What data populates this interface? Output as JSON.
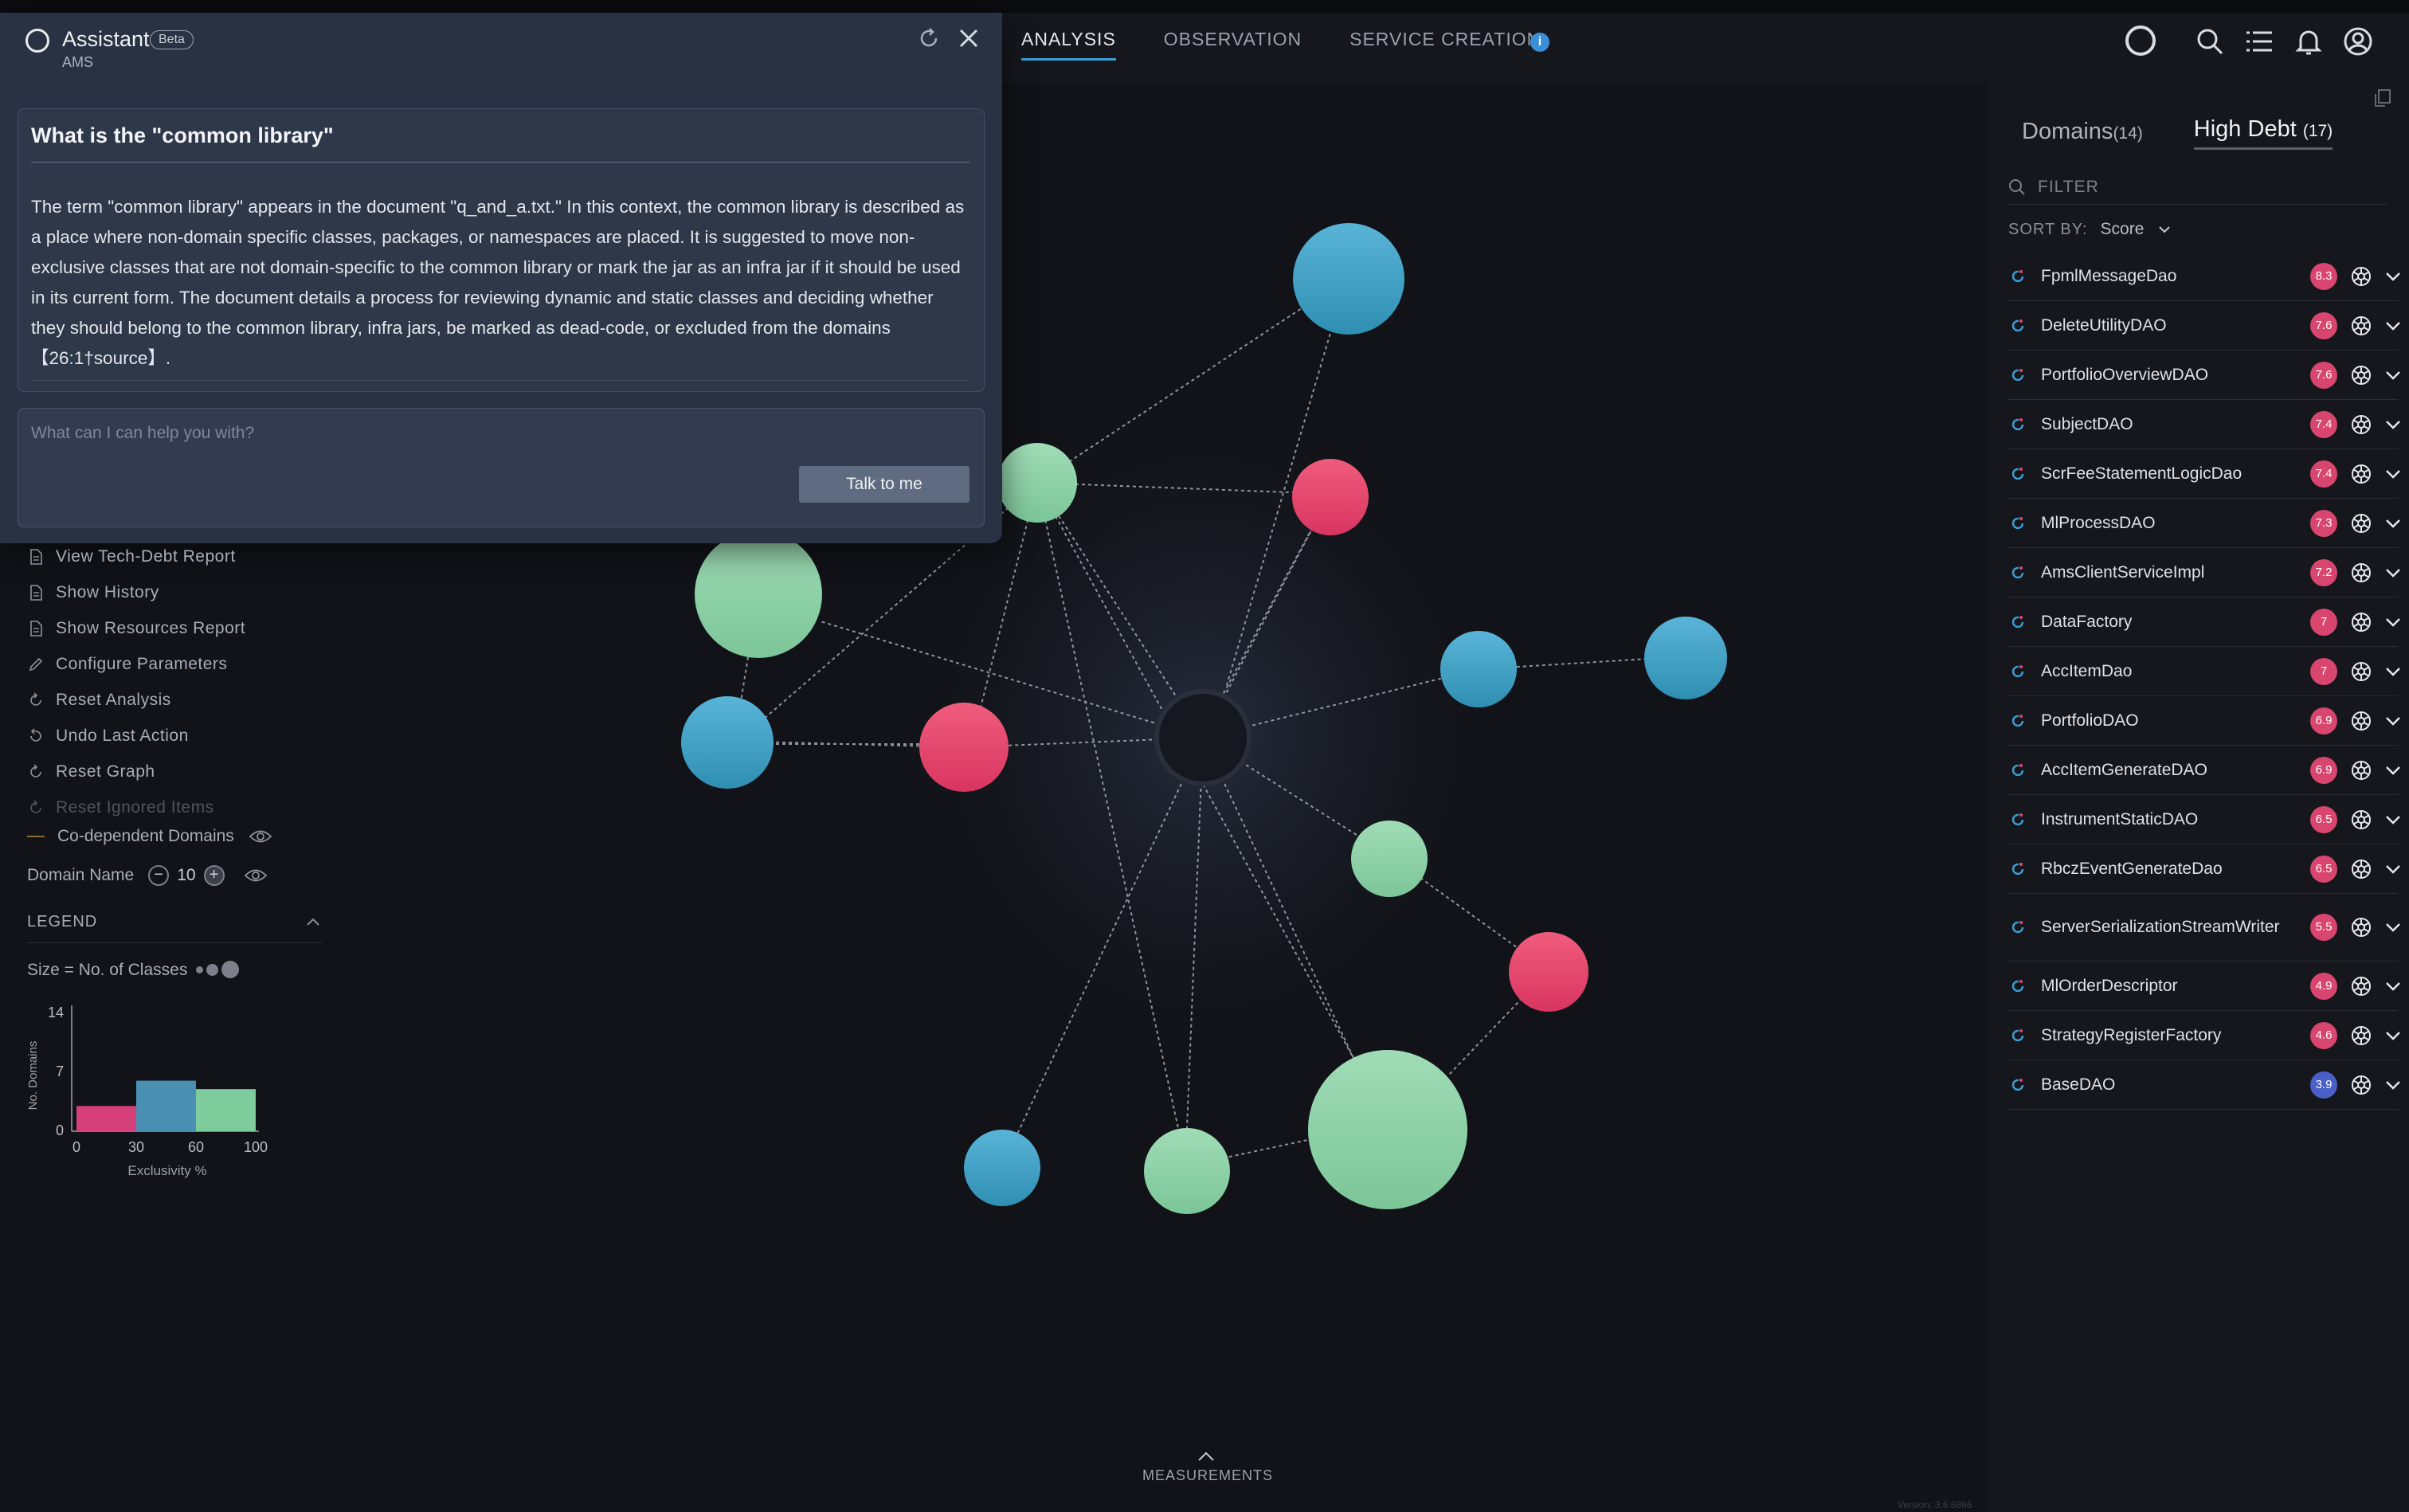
{
  "nav": {
    "tabs": [
      {
        "label": "ANALYSIS"
      },
      {
        "label": "OBSERVATION"
      },
      {
        "label": "SERVICE CREATION"
      }
    ],
    "info_badge": "i",
    "icons": [
      "search-icon",
      "list-icon",
      "bell-icon",
      "user-icon"
    ]
  },
  "assistant": {
    "title": "Assistant",
    "beta": "Beta",
    "subtitle": "AMS",
    "question": "What is the \"common library\"",
    "answer": "The term \"common library\" appears in the document \"q_and_a.txt.\" In this context, the common library is described as a place where non-domain specific classes, packages, or namespaces are placed. It is suggested to move non-exclusive classes that are not domain-specific to the common library or mark the jar as an infra jar if it should be used in its current form. The document details a process for reviewing dynamic and static classes and deciding whether they should belong to the common library, infra jars, be marked as dead-code, or excluded from the domains 【26:1†source】.",
    "input_placeholder": "What can I can help you with?",
    "input_value": "",
    "talk_button": "Talk to me"
  },
  "left_menu": {
    "items": [
      {
        "label": "View Tech-Debt Report",
        "icon": "document-icon"
      },
      {
        "label": "Show History",
        "icon": "document-icon"
      },
      {
        "label": "Show Resources Report",
        "icon": "document-icon"
      },
      {
        "label": "Configure Parameters",
        "icon": "pencil-icon"
      },
      {
        "label": "Reset Analysis",
        "icon": "reset-icon"
      },
      {
        "label": "Undo Last Action",
        "icon": "undo-icon"
      },
      {
        "label": "Reset Graph",
        "icon": "reset-icon"
      },
      {
        "label": "Reset Ignored Items",
        "icon": "reset-icon"
      }
    ],
    "codependent_label": "Co-dependent Domains",
    "domain_name_label": "Domain Name",
    "domain_name_value": "10"
  },
  "legend": {
    "title": "LEGEND",
    "size_label": "Size = No. of Classes"
  },
  "chart_data": {
    "type": "bar",
    "bins": [
      [
        0,
        30
      ],
      [
        30,
        60
      ],
      [
        60,
        100
      ]
    ],
    "values": [
      3,
      6,
      5
    ],
    "colors": [
      "#d43f7a",
      "#4a8fb4",
      "#7ecb9b"
    ],
    "x_ticks": [
      "0",
      "30",
      "60",
      "100"
    ],
    "y_ticks": [
      "0",
      "7",
      "14"
    ],
    "xlabel": "Exclusivity %",
    "ylabel": "No. Domains",
    "ylim": [
      0,
      14
    ]
  },
  "graph": {
    "colors": {
      "blue": "#3f9fc3",
      "green": "#8fd3a9",
      "red": "#e0466c",
      "center": "#16181f"
    }
  },
  "right_panel": {
    "tabs": [
      {
        "label": "Domains",
        "count": "(14)"
      },
      {
        "label": "High Debt",
        "count": "(17)"
      }
    ],
    "filter_placeholder": "FILTER",
    "sort_label": "SORT BY:",
    "sort_value": "Score",
    "items": [
      {
        "name": "FpmlMessageDao",
        "score": "8.3"
      },
      {
        "name": "DeleteUtilityDAO",
        "score": "7.6"
      },
      {
        "name": "PortfolioOverviewDAO",
        "score": "7.6"
      },
      {
        "name": "SubjectDAO",
        "score": "7.4"
      },
      {
        "name": "ScrFeeStatementLogicDao",
        "score": "7.4"
      },
      {
        "name": "MlProcessDAO",
        "score": "7.3"
      },
      {
        "name": "AmsClientServiceImpl",
        "score": "7.2"
      },
      {
        "name": "DataFactory",
        "score": "7"
      },
      {
        "name": "AccItemDao",
        "score": "7"
      },
      {
        "name": "PortfolioDAO",
        "score": "6.9"
      },
      {
        "name": "AccItemGenerateDAO",
        "score": "6.9"
      },
      {
        "name": "InstrumentStaticDAO",
        "score": "6.5"
      },
      {
        "name": "RbczEventGenerateDao",
        "score": "6.5"
      },
      {
        "name": "ServerSerializationStreamWriter",
        "score": "5.5"
      },
      {
        "name": "MlOrderDescriptor",
        "score": "4.9"
      },
      {
        "name": "StrategyRegisterFactory",
        "score": "4.6"
      },
      {
        "name": "BaseDAO",
        "score": "3.9"
      }
    ]
  },
  "footer": {
    "measurements": "MEASUREMENTS",
    "version": "Version: 3.6.6866"
  }
}
